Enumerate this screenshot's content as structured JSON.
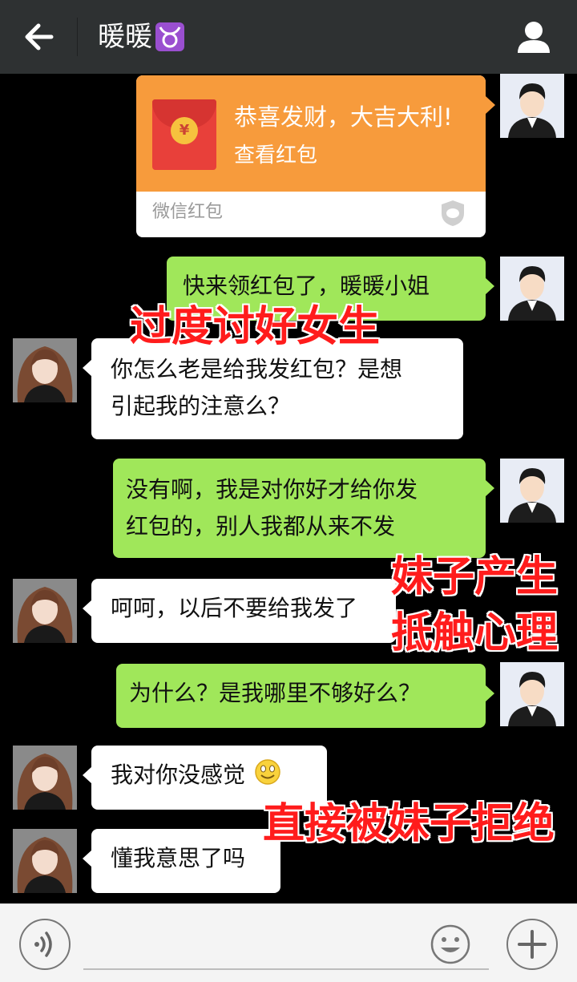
{
  "header": {
    "title": "暖暖"
  },
  "messages": {
    "red_packet": {
      "greeting": "恭喜发财，大吉大利!",
      "action": "查看红包",
      "footer": "微信红包",
      "coin_symbol": "¥"
    },
    "m1": "快来领红包了，暖暖小姐",
    "m2": "你怎么老是给我发红包？是想\n引起我的注意么？",
    "m3": "没有啊，我是对你好才给你发\n红包的，别人我都从来不发",
    "m4": "呵呵，以后不要给我发了",
    "m5": "为什么？是我哪里不够好么？",
    "m6": "我对你没感觉",
    "m7": "懂我意思了吗"
  },
  "annotations": {
    "a1": "过度讨好女生",
    "a2_line1": "妹子产生",
    "a2_line2": "抵触心理",
    "a3": "直接被妹子拒绝"
  },
  "input": {
    "placeholder": ""
  },
  "colors": {
    "header_bg": "#2e3132",
    "chat_bg": "#000000",
    "sent_bubble": "#a0e75a",
    "received_bubble": "#ffffff",
    "red_packet": "#f79b3c",
    "annotation": "#ff1c1c"
  },
  "icons": {
    "back": "arrow-left-icon",
    "profile": "person-icon",
    "zodiac": "taurus-icon",
    "voice": "voice-icon",
    "emoji": "smiley-icon",
    "more": "plus-icon"
  }
}
